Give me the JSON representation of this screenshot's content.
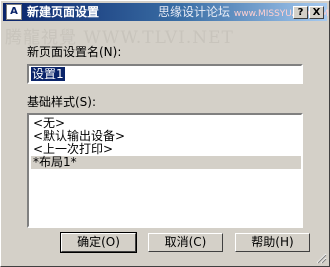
{
  "window": {
    "title": "新建页面设置",
    "icon_name": "autocad-icon",
    "title_watermark": "思缘设计论坛",
    "title_watermark_url": "www.MISSYUAN.COM",
    "help_button": "?",
    "close_button": "X"
  },
  "watermark": "腾龍視覺 WWW.TLVI.NET",
  "form": {
    "name_label": "新页面设置名(N):",
    "name_value": "设置1",
    "base_label": "基础样式(S):"
  },
  "styles_list": {
    "items": [
      "<无>",
      "<默认输出设备>",
      "<上一次打印>",
      "*布局1*"
    ],
    "selected_index": 3
  },
  "buttons": {
    "ok": "确定(O)",
    "cancel": "取消(C)",
    "help": "帮助(H)"
  },
  "colors": {
    "titlebar_start": "#0a246a",
    "titlebar_end": "#a6caf0",
    "face": "#d4d0c8"
  }
}
